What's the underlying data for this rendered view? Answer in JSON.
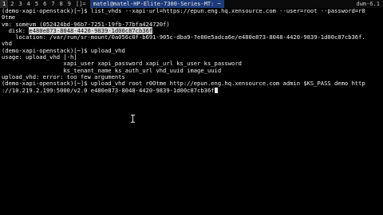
{
  "topbar": {
    "workspaces": [
      "1",
      "2",
      "3",
      "4",
      "5",
      "6",
      "7",
      "8",
      "9"
    ],
    "active_workspace": 0,
    "layout_symbol": "[]=",
    "window_title": "matel@matel-HP-Elite-7300-Series-MT: ~",
    "status_text": "dwm-6.1"
  },
  "terminal": {
    "lines": [
      {
        "text": "(demo-xapi-openstack)[~]$ list_vhds --xapi-url=https://epun.eng.hq.xensource.com --user=root --password=r0"
      },
      {
        "text": "0tme"
      },
      {
        "text": "vm: somevm (052424bd-96b7-7251-19fb-77bfa424720f)"
      },
      {
        "text": "  disk: ",
        "selected": "e480e873-8048-4420-9839-1d00c87cb36f"
      },
      {
        "text": "    location: /var/run/sr-mount/0a056c0f-b691-905c-dba9-7e00e5adca6e/e480e873-8048-4420-9839-1d00c87cb36f."
      },
      {
        "text": "vhd"
      },
      {
        "text": "(demo-xapi-openstack)[~]$ upload_vhd"
      },
      {
        "text": "usage: upload_vhd [-h]"
      },
      {
        "text": "                  xapi_user xapi_password xapi_url ks_user ks_password"
      },
      {
        "text": "                  ks_tenant_name ks_auth_url vhd_uuid image_uuid"
      },
      {
        "text": "upload_vhd: error: too few arguments"
      },
      {
        "text": "(demo-xapi-openstack)[~]$ upload_vhd root r0Otme http://epun.eng.hq.xensource.com admin $KS_PASS demo http"
      },
      {
        "text": "://10.219.2.199:5000/v2.0 e480e873-8048-4420-9839-1d00c87cb36f",
        "cursor": true
      }
    ]
  }
}
